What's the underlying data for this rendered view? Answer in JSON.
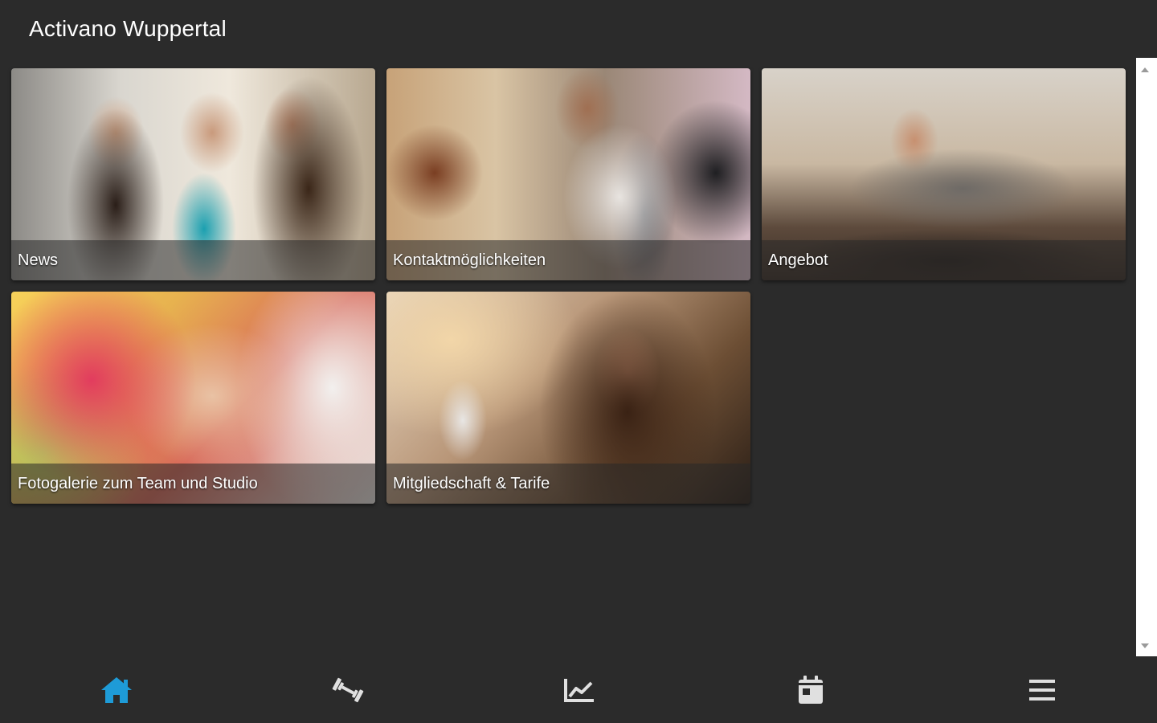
{
  "header": {
    "title": "Activano Wuppertal"
  },
  "tiles": [
    {
      "label": "News"
    },
    {
      "label": "Kontaktmöglichkeiten"
    },
    {
      "label": "Angebot"
    },
    {
      "label": "Fotogalerie zum Team und Studio"
    },
    {
      "label": "Mitgliedschaft & Tarife"
    }
  ],
  "bottom_nav": {
    "items": [
      {
        "icon": "home-icon",
        "active": true
      },
      {
        "icon": "dumbbell-icon",
        "active": false
      },
      {
        "icon": "chart-line-icon",
        "active": false
      },
      {
        "icon": "calendar-icon",
        "active": false
      },
      {
        "icon": "hamburger-menu-icon",
        "active": false
      }
    ]
  },
  "colors": {
    "background": "#2b2b2b",
    "accent": "#1e9bd7",
    "icon_inactive": "#e0e0e0",
    "scrollbar_track": "#ffffff"
  }
}
